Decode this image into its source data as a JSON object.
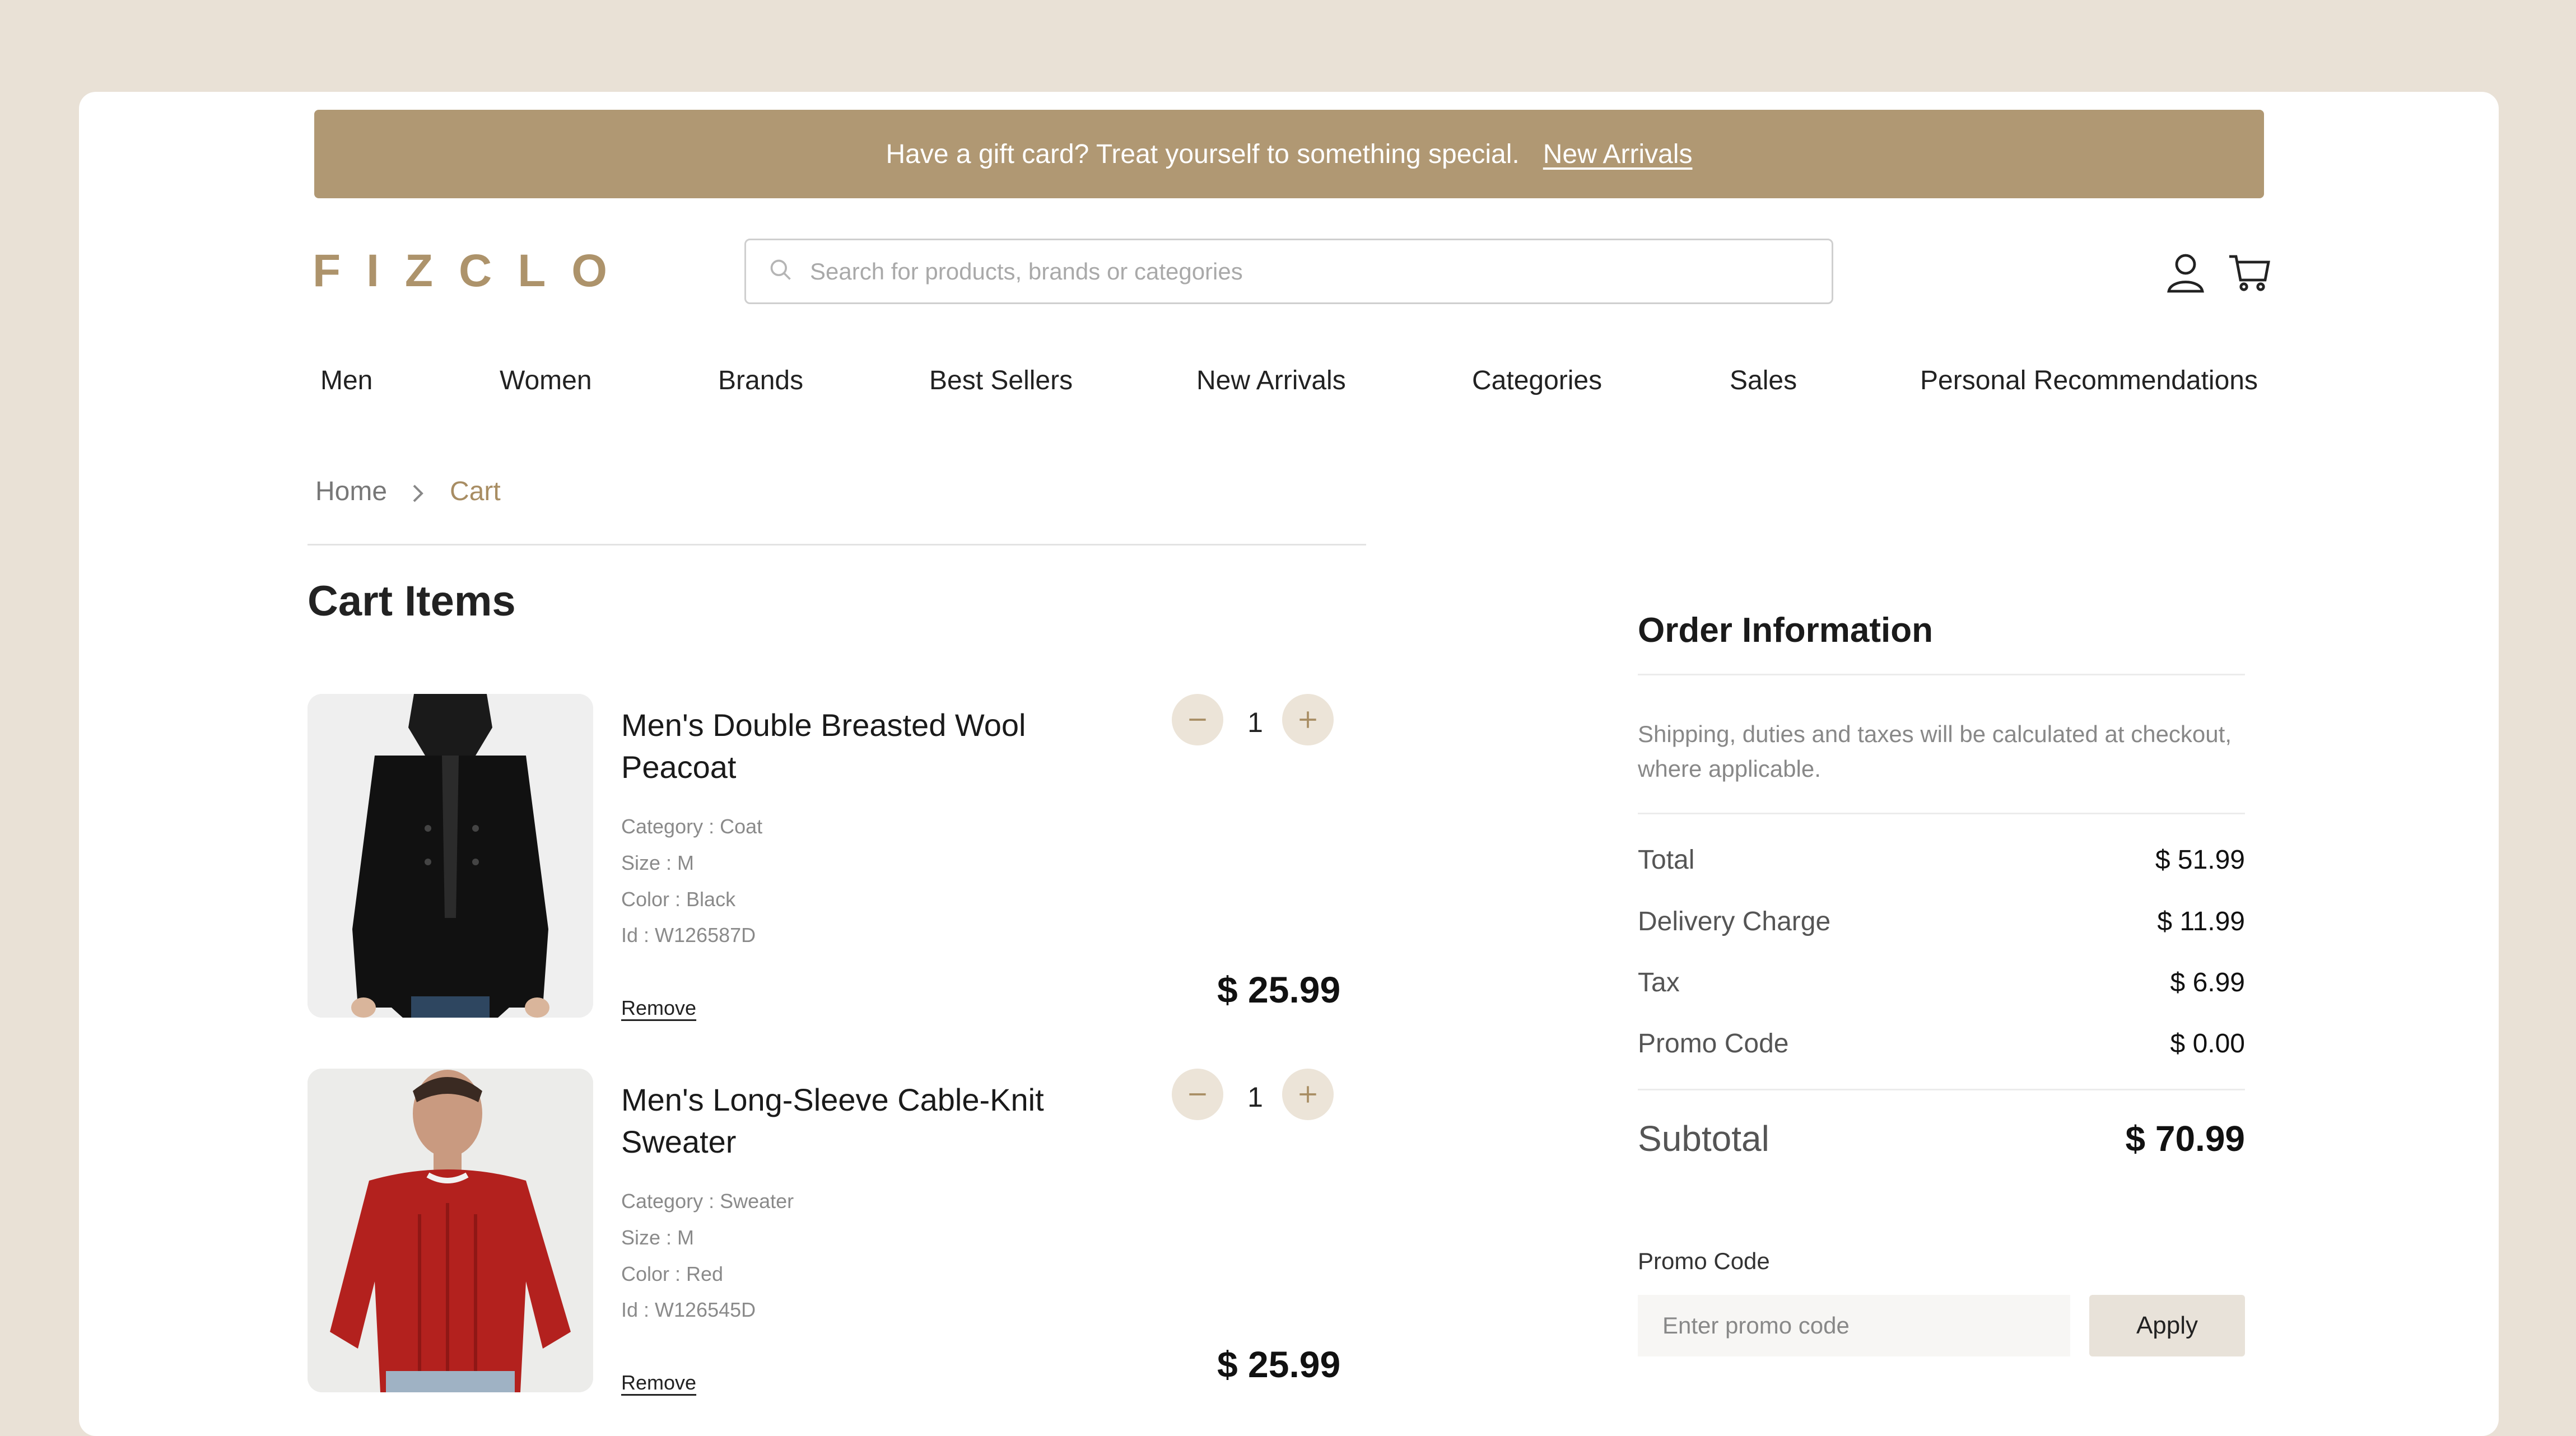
{
  "banner": {
    "text": "Have a gift card? Treat yourself to something special.",
    "link": "New Arrivals"
  },
  "brand": {
    "letters": [
      "F",
      "I",
      "Z",
      "C",
      "L",
      "O"
    ],
    "color": "#ad936b"
  },
  "search": {
    "placeholder": "Search for products, brands or categories"
  },
  "header_icons": [
    "user-icon",
    "cart-icon"
  ],
  "nav": [
    "Men",
    "Women",
    "Brands",
    "Best Sellers",
    "New Arrivals",
    "Categories",
    "Sales",
    "Personal Recommendations"
  ],
  "breadcrumb": {
    "home": "Home",
    "current": "Cart"
  },
  "cart": {
    "title": "Cart Items",
    "items": [
      {
        "name": "Men's Double Breasted Wool Peacoat",
        "category": "Category : Coat",
        "size": "Size : M",
        "color": "Color : Black",
        "id": "Id : W126587D",
        "qty": "1",
        "price": "$ 25.99",
        "remove": "Remove"
      },
      {
        "name": "Men's Long-Sleeve Cable-Knit Sweater",
        "category": "Category : Sweater",
        "size": "Size : M",
        "color": "Color : Red",
        "id": "Id : W126545D",
        "qty": "1",
        "price": "$ 25.99",
        "remove": "Remove"
      }
    ]
  },
  "order": {
    "title": "Order Information",
    "note": "Shipping, duties and taxes will be calculated at checkout, where applicable.",
    "rows": [
      {
        "label": "Total",
        "value": "$ 51.99"
      },
      {
        "label": "Delivery Charge",
        "value": "$ 11.99"
      },
      {
        "label": "Tax",
        "value": "$ 6.99"
      },
      {
        "label": "Promo Code",
        "value": "$ 0.00"
      }
    ],
    "subtotal": {
      "label": "Subtotal",
      "value": "$ 70.99"
    },
    "promo": {
      "label": "Promo Code",
      "placeholder": "Enter promo code",
      "button": "Apply"
    }
  },
  "colors": {
    "accent": "#b09873",
    "background": "#e9e1d6",
    "qty_button": "#ece4d8"
  }
}
